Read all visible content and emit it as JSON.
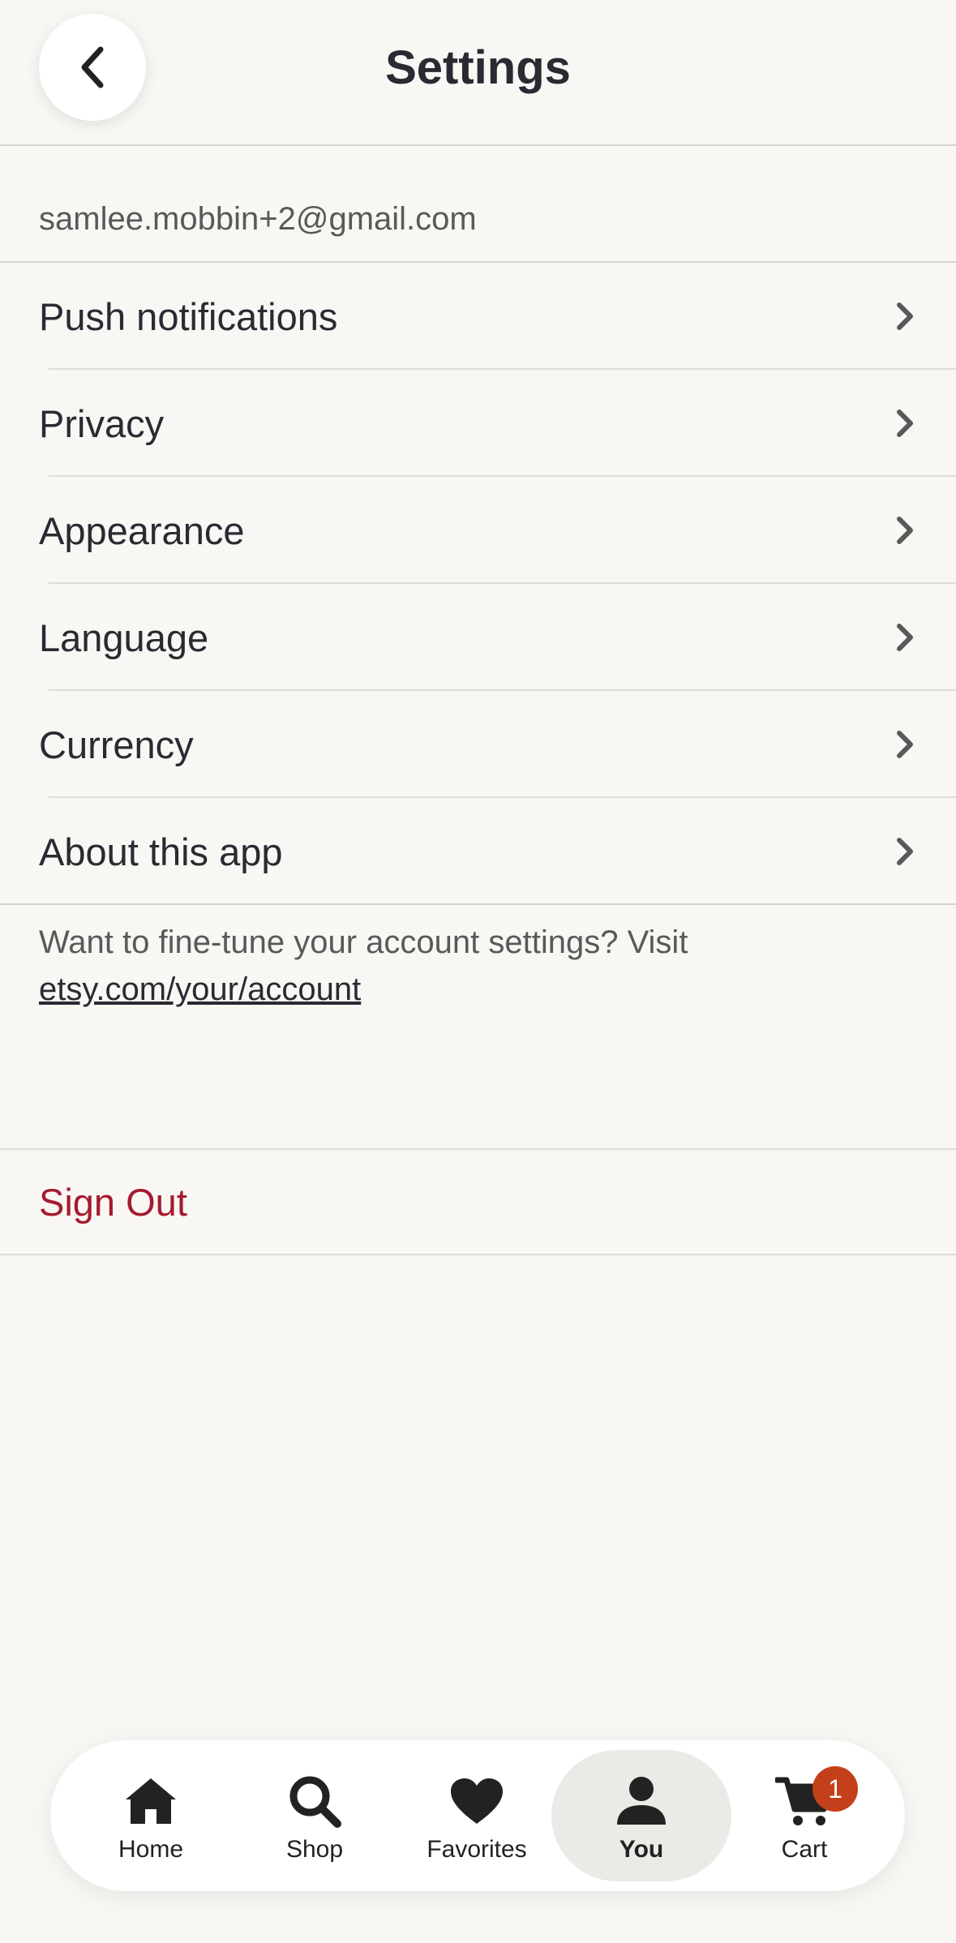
{
  "header": {
    "title": "Settings",
    "back_icon": "chevron-left-icon"
  },
  "account": {
    "email": "samlee.mobbin+2@gmail.com"
  },
  "menu": {
    "items": [
      {
        "label": "Push notifications"
      },
      {
        "label": "Privacy"
      },
      {
        "label": "Appearance"
      },
      {
        "label": "Language"
      },
      {
        "label": "Currency"
      },
      {
        "label": "About this app"
      }
    ],
    "chevron_icon": "chevron-right-icon"
  },
  "help": {
    "text": "Want to fine-tune your account settings? Visit ",
    "link": "etsy.com/your/account"
  },
  "signout": {
    "label": "Sign Out",
    "color": "#a61a2e"
  },
  "tabbar": {
    "tabs": [
      {
        "label": "Home",
        "icon": "home-icon"
      },
      {
        "label": "Shop",
        "icon": "search-icon"
      },
      {
        "label": "Favorites",
        "icon": "heart-icon"
      },
      {
        "label": "You",
        "icon": "person-icon",
        "active": true
      },
      {
        "label": "Cart",
        "icon": "cart-icon"
      }
    ],
    "cart_badge": "1",
    "badge_color": "#c4401b"
  }
}
